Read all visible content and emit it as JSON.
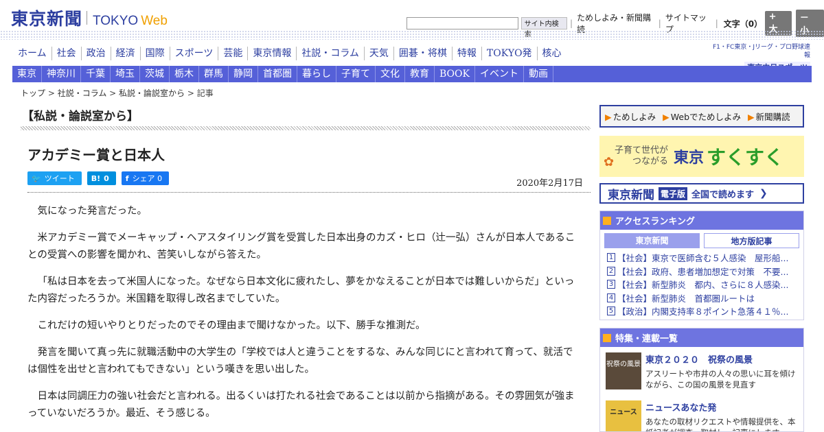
{
  "header": {
    "logo_jp": "東京新聞",
    "logo_en": "TOKYO",
    "logo_web": "Web",
    "search_button": "サイト内検索",
    "links": [
      "ためしよみ・新聞購読",
      "サイトマップ"
    ],
    "fontsize_label": "文字（0）",
    "fontsize_up": "+ 大",
    "fontsize_down": "－ 小"
  },
  "main_nav": [
    "ホーム",
    "社会",
    "政治",
    "経済",
    "国際",
    "スポーツ",
    "芸能",
    "東京情報",
    "社説・コラム",
    "天気",
    "囲碁・将棋",
    "特報",
    "TOKYO発",
    "核心"
  ],
  "sub_nav": [
    "東京",
    "神奈川",
    "千葉",
    "埼玉",
    "茨城",
    "栃木",
    "群馬",
    "静岡",
    "首都圏",
    "暮らし",
    "子育て",
    "文化",
    "教育",
    "BOOK",
    "イベント",
    "動画"
  ],
  "chunichi": {
    "line1": "F1・FC東京・Jリーグ・プロ野球速報",
    "line2": "東京中日スポーツ"
  },
  "breadcrumb": {
    "top": "トップ",
    "column": "社説・コラム",
    "section": "私説・論説室から",
    "article": "記事"
  },
  "section_title": "【私説・論説室から】",
  "article": {
    "title": "アカデミー賞と日本人",
    "date": "2020年2月17日",
    "share": {
      "tweet": "ツイート",
      "hatena_label": "B!",
      "hatena_count": "0",
      "facebook": "シェア",
      "facebook_count": "0"
    },
    "paragraphs": [
      "気になった発言だった。",
      "米アカデミー賞でメーキャップ・ヘアスタイリング賞を受賞した日本出身のカズ・ヒロ（辻一弘）さんが日本人であることの受賞への影響を聞かれ、苦笑いしながら答えた。",
      "「私は日本を去って米国人になった。なぜなら日本文化に疲れたし、夢をかなえることが日本では難しいからだ」といった内容だったろうか。米国籍を取得し改名までしていた。",
      "これだけの短いやりとりだったのでその理由まで聞けなかった。以下、勝手な推測だ。",
      "発言を聞いて真っ先に就職活動中の大学生の「学校では人と違うことをするな、みんな同じにと言われて育って、就活では個性を出せと言われてもできない」という嘆きを思い出した。",
      "日本は同調圧力の強い社会だと言われる。出るくいは打たれる社会であることは以前から指摘がある。その雰囲気が強まっていないだろうか。最近、そう感じる。"
    ]
  },
  "sidebar": {
    "links": [
      "ためしよみ",
      "Webでためしよみ",
      "新聞購読"
    ],
    "sukusuku": {
      "tagline1": "子育て世代が",
      "tagline2": "つながる",
      "brand1": "東京",
      "brand2": "すくすく"
    },
    "denshi": {
      "name": "東京新聞",
      "badge": "電子版",
      "text": "全国で読めます"
    },
    "ranking": {
      "title": "アクセスランキング",
      "tab_on": "東京新聞",
      "tab_off": "地方版記事",
      "items": [
        {
          "num": "1",
          "text": "【社会】東京で医師含む５人感染　屋形船..."
        },
        {
          "num": "2",
          "text": "【社会】政府、患者増加想定で対策　不要..."
        },
        {
          "num": "3",
          "text": "【社会】新型肺炎　都内、さらに８人感染..."
        },
        {
          "num": "4",
          "text": "【社会】新型肺炎　首都圏ルートは"
        },
        {
          "num": "5",
          "text": "【政治】内閣支持率８ポイント急落４１％..."
        }
      ]
    },
    "features": {
      "title": "特集・連載一覧",
      "items": [
        {
          "thumb": "祝祭の風景",
          "title": "東京２０２０　祝祭の風景",
          "desc": "アスリートや市井の人々の思いに耳を傾けながら、この国の風景を見直す"
        },
        {
          "thumb": "ニュース",
          "title": "ニュースあなた発",
          "desc": "あなたの取材リクエストや情報提供を、本紙記者が調査・取材し、記事にします。"
        }
      ]
    }
  },
  "colors": {
    "brand": "#2d3fa0",
    "nav_bg": "#5560d8",
    "accent": "#f0a000"
  }
}
